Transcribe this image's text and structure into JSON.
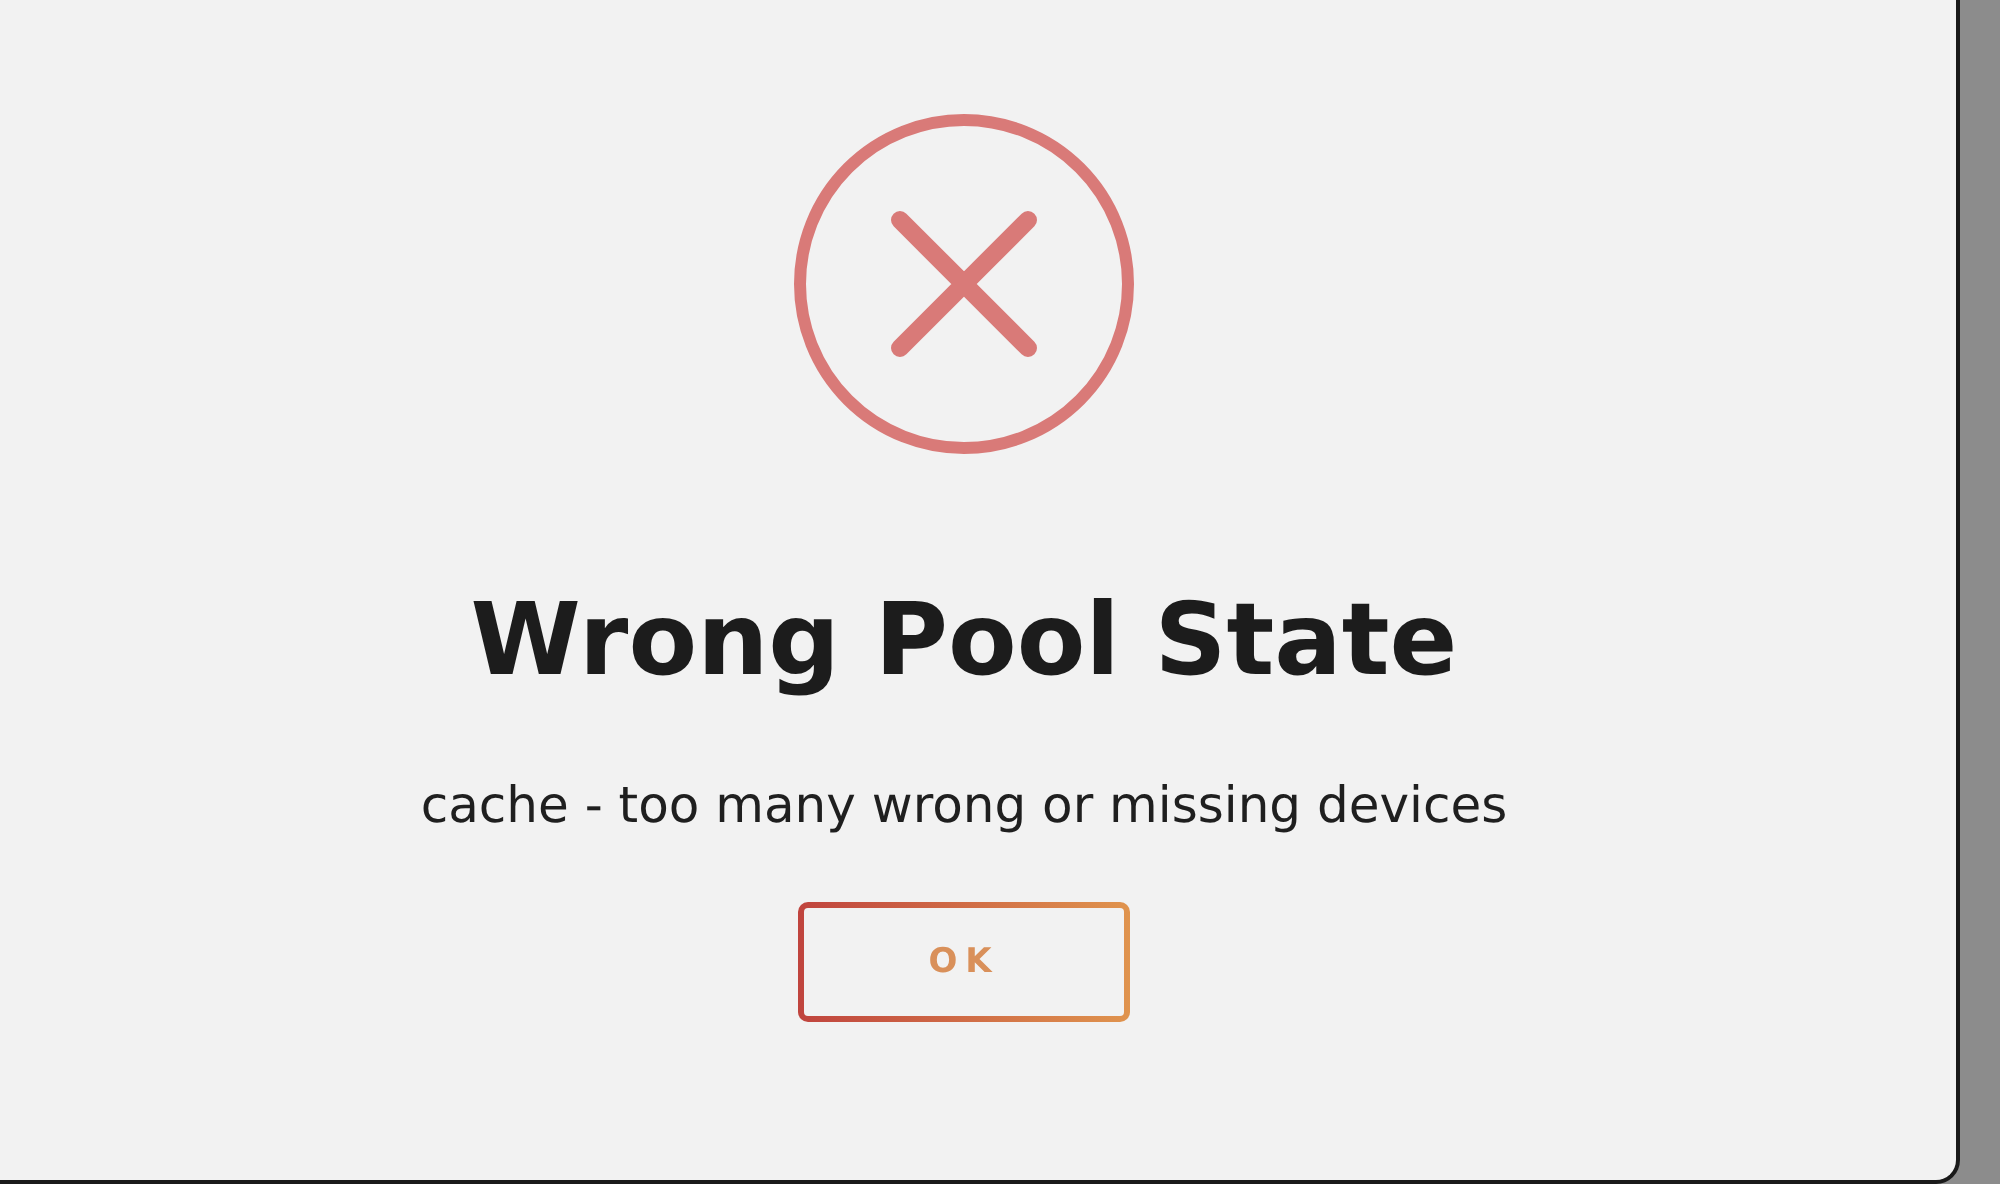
{
  "dialog": {
    "kind": "error",
    "title": "Wrong Pool State",
    "message": "cache - too many wrong or missing devices",
    "buttons": [
      "OK"
    ]
  }
}
